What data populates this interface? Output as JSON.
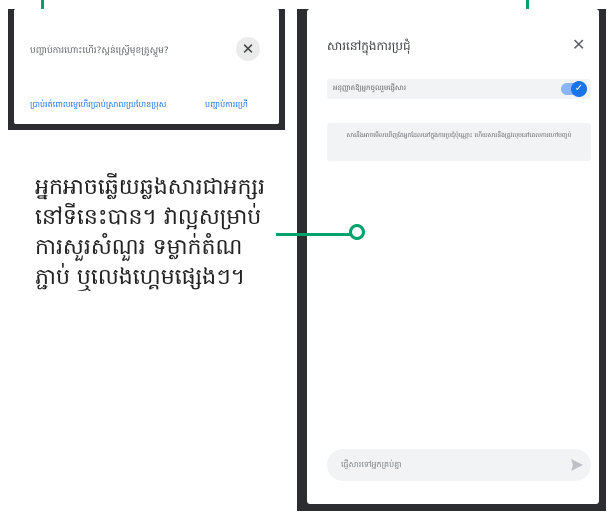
{
  "popup": {
    "question": "បញ្ហាប់ការហោះហើរ?ស្គន់ស្វ្រើមុខត្រូស្តួម?",
    "close_glyph": "✕",
    "link_one": "ប្រាប់រត់ពោលម្ទេហើរប្រាប់ស្រាលយ្រហែនប្រុស",
    "link_two": "បញ្ហាប់ការហ្រើ"
  },
  "panel": {
    "title": "សារនៅក្នុងការប្រជុំ",
    "close_glyph": "✕",
    "toggle_label": "អនុញ្ញាតឱ្យអ្នកចូលរួមផ្ញើសារ",
    "toggle_check": "✓",
    "info_text": "សារនឹងអាចមើលឃើញតែអ្នកដែលនៅក្នុងការប្រជុំប៉ុណ្ណោះ ហើយសារនឹងត្រូវលុបនៅពេលការហៅបញ្ចប់",
    "message_placeholder": "ផ្ញើសារទៅអ្នកគ្រប់គ្នា"
  },
  "caption": {
    "text": "អ្នកអាចឆ្លើយឆ្លងសារជាអក្សរនៅទីនេះបាន។ វាល្អសម្រាប់ការសួរសំណួរ ទម្លាក់តំណភ្ជាប់ ឬលេងហ្គេមផ្សេងៗ។"
  },
  "colors": {
    "accent_green": "#00a36c",
    "link_blue": "#1a73e8",
    "frame_dark": "#2b2d31"
  }
}
